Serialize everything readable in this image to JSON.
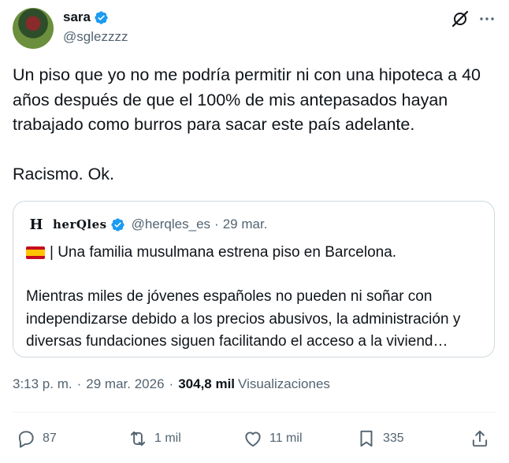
{
  "author": {
    "display_name": "sara",
    "handle": "@sglezzzz"
  },
  "tweet_text": "Un piso que yo no me podría permitir ni con una hipoteca a 40 años después de que el 100% de mis antepasados hayan trabajado como burros para sacar este país adelante.\n\nRacismo. Ok.",
  "quote": {
    "logo_text": "H",
    "name": "herQles",
    "handle": "@herqles_es",
    "separator": "·",
    "date": "29 mar.",
    "headline": "| Una familia musulmana estrena piso en Barcelona.",
    "body": "Mientras miles de jóvenes españoles no pueden ni soñar con independizarse debido a los precios abusivos, la administración y diversas fundaciones siguen facilitando el acceso a la viviend…"
  },
  "meta": {
    "time": "3:13 p. m.",
    "separator": "·",
    "date": "29 mar. 2026",
    "separator2": "·",
    "views_count": "304,8 mil",
    "views_label": "Visualizaciones"
  },
  "actions": {
    "replies": "87",
    "reposts": "1 mil",
    "likes": "11 mil",
    "bookmarks": "335"
  },
  "colors": {
    "verified_blue": "#1d9bf0",
    "secondary_text": "#536471",
    "primary_text": "#0f1419",
    "border": "#cfd9de"
  },
  "icons": [
    "verified-badge-icon",
    "grok-icon",
    "more-options-icon",
    "spain-flag-icon",
    "reply-icon",
    "repost-icon",
    "like-icon",
    "bookmark-icon",
    "share-icon"
  ]
}
